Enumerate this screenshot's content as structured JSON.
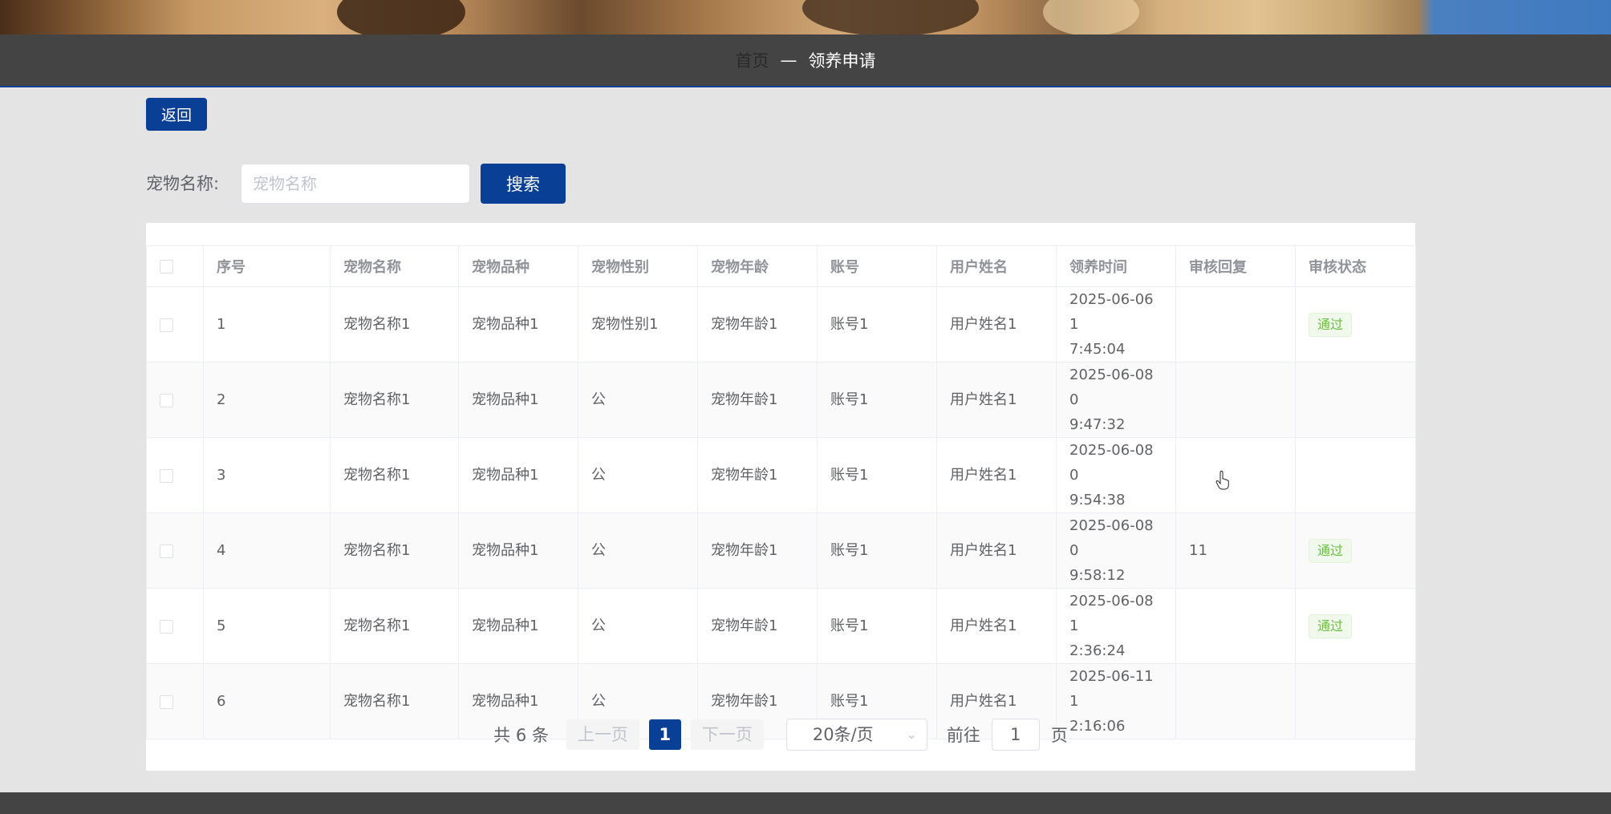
{
  "nav": {
    "home": "首页",
    "separator": "—",
    "current": "领养申请"
  },
  "back_button": "返回",
  "search": {
    "label": "宠物名称:",
    "placeholder": "宠物名称",
    "value": "",
    "button": "搜索"
  },
  "table": {
    "headers": [
      "序号",
      "宠物名称",
      "宠物品种",
      "宠物性别",
      "宠物年龄",
      "账号",
      "用户姓名",
      "领养时间",
      "审核回复",
      "审核状态"
    ],
    "rows": [
      {
        "index": "1",
        "pet_name": "宠物名称1",
        "breed": "宠物品种1",
        "gender": "宠物性别1",
        "age": "宠物年龄1",
        "account": "账号1",
        "user_name": "用户姓名1",
        "time_line1": "2025-06-06 1",
        "time_line2": "7:45:04",
        "reply": "",
        "status": "通过"
      },
      {
        "index": "2",
        "pet_name": "宠物名称1",
        "breed": "宠物品种1",
        "gender": "公",
        "age": "宠物年龄1",
        "account": "账号1",
        "user_name": "用户姓名1",
        "time_line1": "2025-06-08 0",
        "time_line2": "9:47:32",
        "reply": "",
        "status": ""
      },
      {
        "index": "3",
        "pet_name": "宠物名称1",
        "breed": "宠物品种1",
        "gender": "公",
        "age": "宠物年龄1",
        "account": "账号1",
        "user_name": "用户姓名1",
        "time_line1": "2025-06-08 0",
        "time_line2": "9:54:38",
        "reply": "",
        "status": ""
      },
      {
        "index": "4",
        "pet_name": "宠物名称1",
        "breed": "宠物品种1",
        "gender": "公",
        "age": "宠物年龄1",
        "account": "账号1",
        "user_name": "用户姓名1",
        "time_line1": "2025-06-08 0",
        "time_line2": "9:58:12",
        "reply": "11",
        "status": "通过"
      },
      {
        "index": "5",
        "pet_name": "宠物名称1",
        "breed": "宠物品种1",
        "gender": "公",
        "age": "宠物年龄1",
        "account": "账号1",
        "user_name": "用户姓名1",
        "time_line1": "2025-06-08 1",
        "time_line2": "2:36:24",
        "reply": "",
        "status": "通过"
      },
      {
        "index": "6",
        "pet_name": "宠物名称1",
        "breed": "宠物品种1",
        "gender": "公",
        "age": "宠物年龄1",
        "account": "账号1",
        "user_name": "用户姓名1",
        "time_line1": "2025-06-11 1",
        "time_line2": "2:16:06",
        "reply": "",
        "status": ""
      }
    ]
  },
  "pagination": {
    "total": "共 6 条",
    "prev": "上一页",
    "current_page": "1",
    "next": "下一页",
    "page_size": "20条/页",
    "goto_label": "前往",
    "goto_value": "1",
    "page_suffix": "页"
  },
  "colors": {
    "primary": "#0a3f96",
    "nav_bg": "#444444",
    "page_bg": "#e4e4e4",
    "status_pass": "#67c23a"
  }
}
